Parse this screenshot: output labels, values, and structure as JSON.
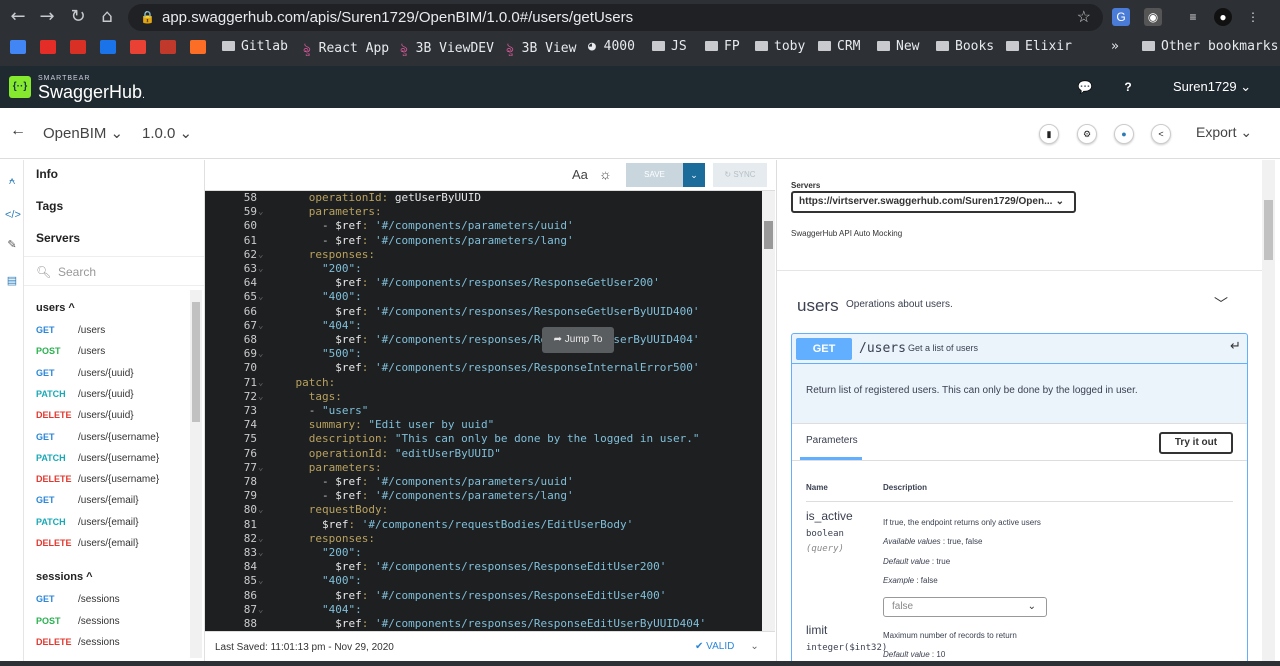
{
  "browser": {
    "url": "app.swaggerhub.com/apis/Suren1729/OpenBIM/1.0.0#/users/getUsers",
    "bookmarks": [
      "Gitlab",
      "React App",
      "3B ViewDEV",
      "3B View",
      "4000",
      "JS",
      "FP",
      "toby",
      "CRM",
      "New",
      "Books",
      "Elixir"
    ],
    "overflow": "»",
    "other_bookmarks": "Other bookmarks"
  },
  "header": {
    "brand_small": "SMARTBEAR",
    "brand": "SwaggerHub",
    "brand_suffix": ".",
    "user": "Suren1729 ⌄"
  },
  "apibar": {
    "api_name": "OpenBIM ⌄",
    "version": "1.0.0 ⌄",
    "export": "Export ⌄"
  },
  "nav": {
    "info": "Info",
    "tags": "Tags",
    "servers": "Servers",
    "search_placeholder": "Search",
    "groups": [
      {
        "name": "users ^",
        "endpoints": [
          {
            "method": "GET",
            "path": "/users"
          },
          {
            "method": "POST",
            "path": "/users"
          },
          {
            "method": "GET",
            "path": "/users/{uuid}"
          },
          {
            "method": "PATCH",
            "path": "/users/{uuid}"
          },
          {
            "method": "DELETE",
            "path": "/users/{uuid}"
          },
          {
            "method": "GET",
            "path": "/users/{username}"
          },
          {
            "method": "PATCH",
            "path": "/users/{username}"
          },
          {
            "method": "DELETE",
            "path": "/users/{username}"
          },
          {
            "method": "GET",
            "path": "/users/{email}"
          },
          {
            "method": "PATCH",
            "path": "/users/{email}"
          },
          {
            "method": "DELETE",
            "path": "/users/{email}"
          }
        ]
      },
      {
        "name": "sessions ^",
        "endpoints": [
          {
            "method": "GET",
            "path": "/sessions"
          },
          {
            "method": "POST",
            "path": "/sessions"
          },
          {
            "method": "DELETE",
            "path": "/sessions"
          }
        ]
      }
    ]
  },
  "editor_toolbar": {
    "font_label": "Aa",
    "save": "SAVE",
    "sync": "SYNC"
  },
  "editor": {
    "jump_to": "Jump To",
    "lines": [
      {
        "n": "58",
        "fold": false,
        "code": "      operationId: getUserByUUID"
      },
      {
        "n": "59",
        "fold": true,
        "code": "      parameters:"
      },
      {
        "n": "60",
        "fold": false,
        "code": "        - $ref: '#/components/parameters/uuid'"
      },
      {
        "n": "61",
        "fold": false,
        "code": "        - $ref: '#/components/parameters/lang'"
      },
      {
        "n": "62",
        "fold": true,
        "code": "      responses:"
      },
      {
        "n": "63",
        "fold": true,
        "code": "        \"200\":"
      },
      {
        "n": "64",
        "fold": false,
        "code": "          $ref: '#/components/responses/ResponseGetUser200'"
      },
      {
        "n": "65",
        "fold": true,
        "code": "        \"400\":"
      },
      {
        "n": "66",
        "fold": false,
        "code": "          $ref: '#/components/responses/ResponseGetUserByUUID400'"
      },
      {
        "n": "67",
        "fold": true,
        "code": "        \"404\":"
      },
      {
        "n": "68",
        "fold": false,
        "code": "          $ref: '#/components/responses/ResponseGetUserByUUID404'"
      },
      {
        "n": "69",
        "fold": true,
        "code": "        \"500\":"
      },
      {
        "n": "70",
        "fold": false,
        "code": "          $ref: '#/components/responses/ResponseInternalError500'"
      },
      {
        "n": "71",
        "fold": true,
        "code": "    patch:"
      },
      {
        "n": "72",
        "fold": true,
        "code": "      tags:"
      },
      {
        "n": "73",
        "fold": false,
        "code": "      - \"users\""
      },
      {
        "n": "74",
        "fold": false,
        "code": "      summary: \"Edit user by uuid\""
      },
      {
        "n": "75",
        "fold": false,
        "code": "      description: \"This can only be done by the logged in user.\""
      },
      {
        "n": "76",
        "fold": false,
        "code": "      operationId: \"editUserByUUID\""
      },
      {
        "n": "77",
        "fold": true,
        "code": "      parameters:"
      },
      {
        "n": "78",
        "fold": false,
        "code": "        - $ref: '#/components/parameters/uuid'"
      },
      {
        "n": "79",
        "fold": false,
        "code": "        - $ref: '#/components/parameters/lang'"
      },
      {
        "n": "80",
        "fold": true,
        "code": "      requestBody:"
      },
      {
        "n": "81",
        "fold": false,
        "code": "        $ref: '#/components/requestBodies/EditUserBody'"
      },
      {
        "n": "82",
        "fold": true,
        "code": "      responses:"
      },
      {
        "n": "83",
        "fold": true,
        "code": "        \"200\":"
      },
      {
        "n": "84",
        "fold": false,
        "code": "          $ref: '#/components/responses/ResponseEditUser200'"
      },
      {
        "n": "85",
        "fold": true,
        "code": "        \"400\":"
      },
      {
        "n": "86",
        "fold": false,
        "code": "          $ref: '#/components/responses/ResponseEditUser400'"
      },
      {
        "n": "87",
        "fold": true,
        "code": "        \"404\":"
      },
      {
        "n": "88",
        "fold": false,
        "code": "          $ref: '#/components/responses/ResponseEditUserByUUID404'"
      }
    ]
  },
  "status": {
    "saved": "Last Saved:  11:01:13 pm  -  Nov 29, 2020",
    "valid": "✔ VALID"
  },
  "docs": {
    "servers_label": "Servers",
    "server_url": "https://virtserver.swaggerhub.com/Suren1729/Open...",
    "mock_label": "SwaggerHub API Auto Mocking",
    "tag": "users",
    "tag_desc": "Operations about users.",
    "op": {
      "method": "GET",
      "path": "/users",
      "summary": "Get a list of users",
      "description": "Return list of registered users. This can only be done by the logged in user.",
      "params_tab": "Parameters",
      "try_it": "Try it out",
      "col_name": "Name",
      "col_desc": "Description",
      "params": [
        {
          "name": "is_active",
          "type": "boolean",
          "in": "(query)",
          "desc": "If true, the endpoint returns only active users",
          "available_label": "Available values",
          "available": " : true, false",
          "default_label": "Default value",
          "default": " : true",
          "example_label": "Example",
          "example": " : false",
          "select": "false"
        },
        {
          "name": "limit",
          "type": "integer($int32)",
          "desc": "Maximum number of records to return",
          "default_label": "Default value",
          "default": " : 10"
        }
      ]
    }
  },
  "colors": {
    "get": "#61affe",
    "post": "#2ab24f",
    "patch": "#18a8b7",
    "delete": "#e0382f",
    "header_bg": "#1f2a30"
  }
}
